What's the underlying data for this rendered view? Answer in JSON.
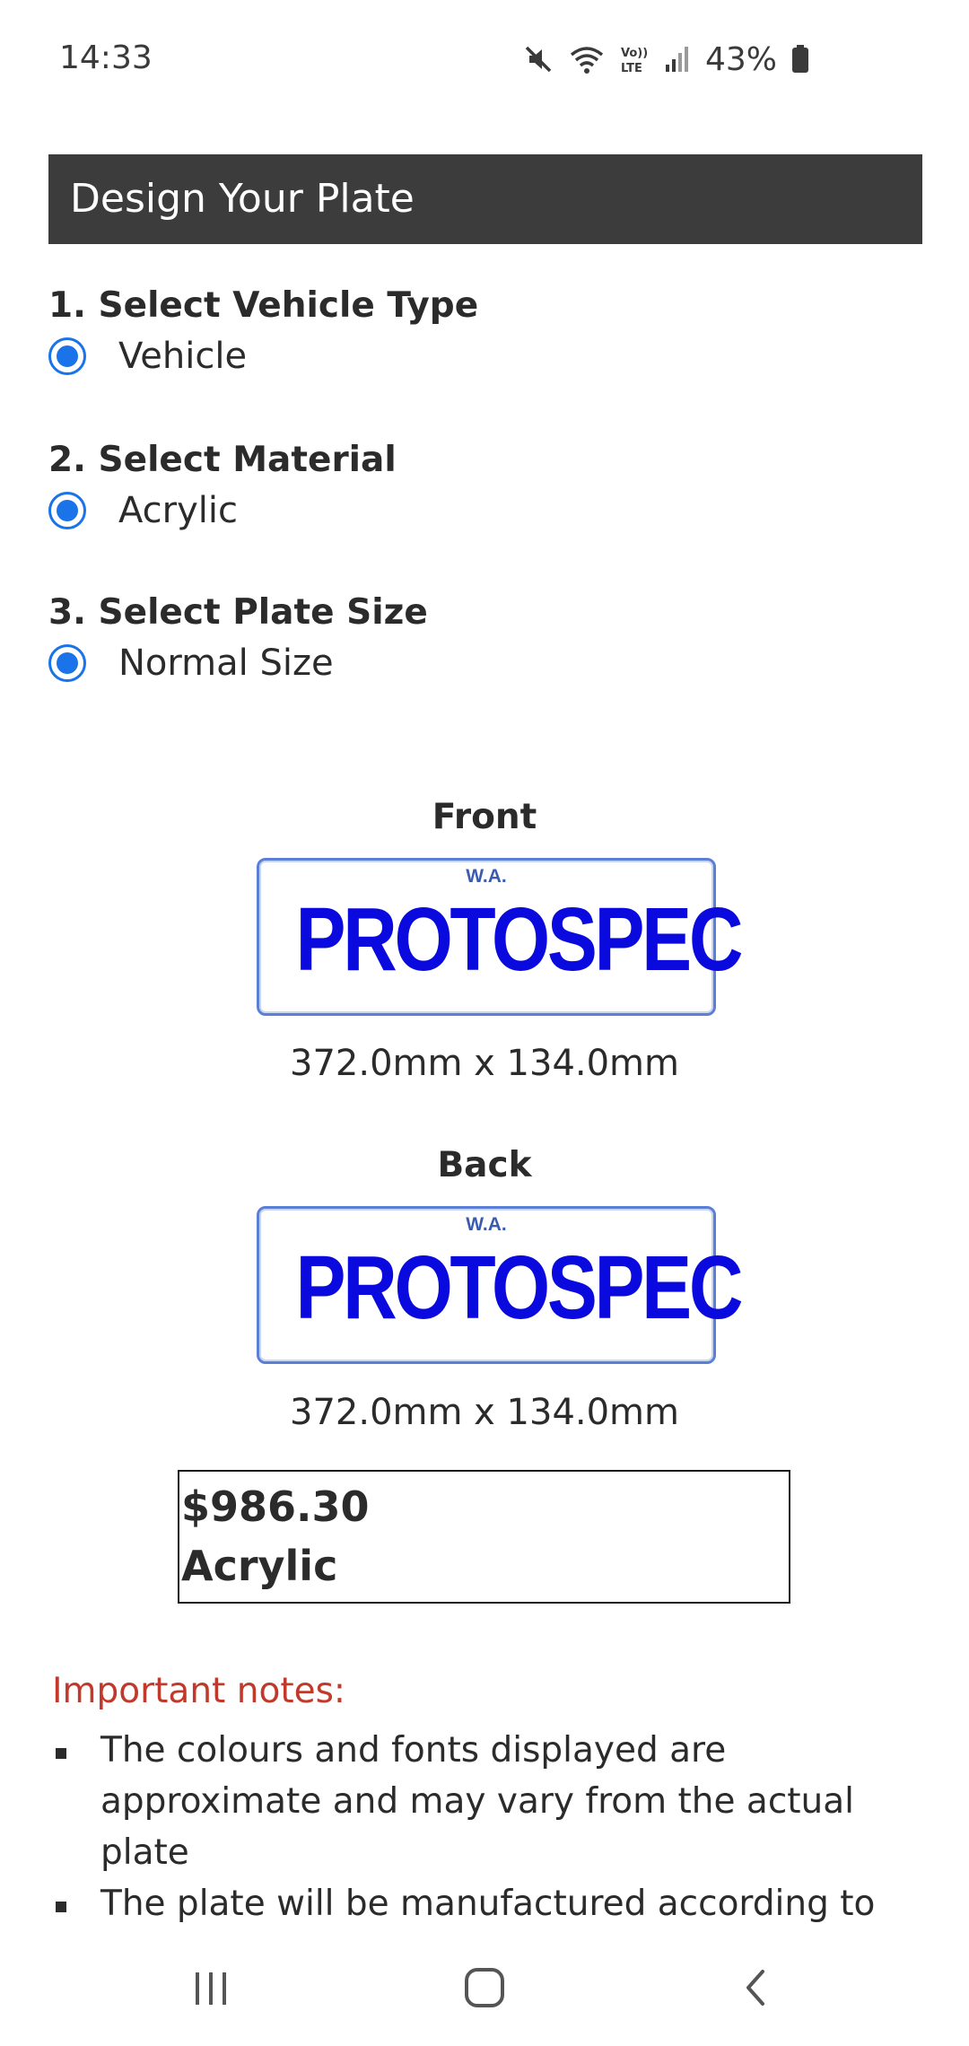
{
  "status_bar": {
    "time": "14:33",
    "battery": "43%",
    "icons": [
      "mute-icon",
      "wifi-icon",
      "volte-icon",
      "signal-icon",
      "battery-icon"
    ]
  },
  "header": {
    "title": "Design Your Plate"
  },
  "sections": [
    {
      "heading": "1. Select Vehicle Type",
      "option": "Vehicle",
      "selected": true
    },
    {
      "heading": "2. Select Material",
      "option": "Acrylic",
      "selected": true
    },
    {
      "heading": "3. Select Plate Size",
      "option": "Normal Size",
      "selected": true
    }
  ],
  "plates": {
    "front": {
      "label": "Front",
      "state": "W.A.",
      "text": "PROTOSPEC",
      "dimensions": "372.0mm x 134.0mm"
    },
    "back": {
      "label": "Back",
      "state": "W.A.",
      "text": "PROTOSPEC",
      "dimensions": "372.0mm x 134.0mm"
    }
  },
  "summary": {
    "price": "$986.30",
    "material": "Acrylic"
  },
  "notes": {
    "title": "Important notes:",
    "items": [
      "The colours and fonts displayed are approximate and may vary from the actual plate",
      "The plate will be manufactured according to"
    ]
  },
  "nav": {
    "buttons": [
      "recent-apps-icon",
      "home-icon",
      "back-icon"
    ]
  },
  "colors": {
    "accent": "#1a73e8",
    "header_bg": "#3c3c3c",
    "plate_text": "#0a0adf",
    "notes_title": "#c0392b"
  }
}
